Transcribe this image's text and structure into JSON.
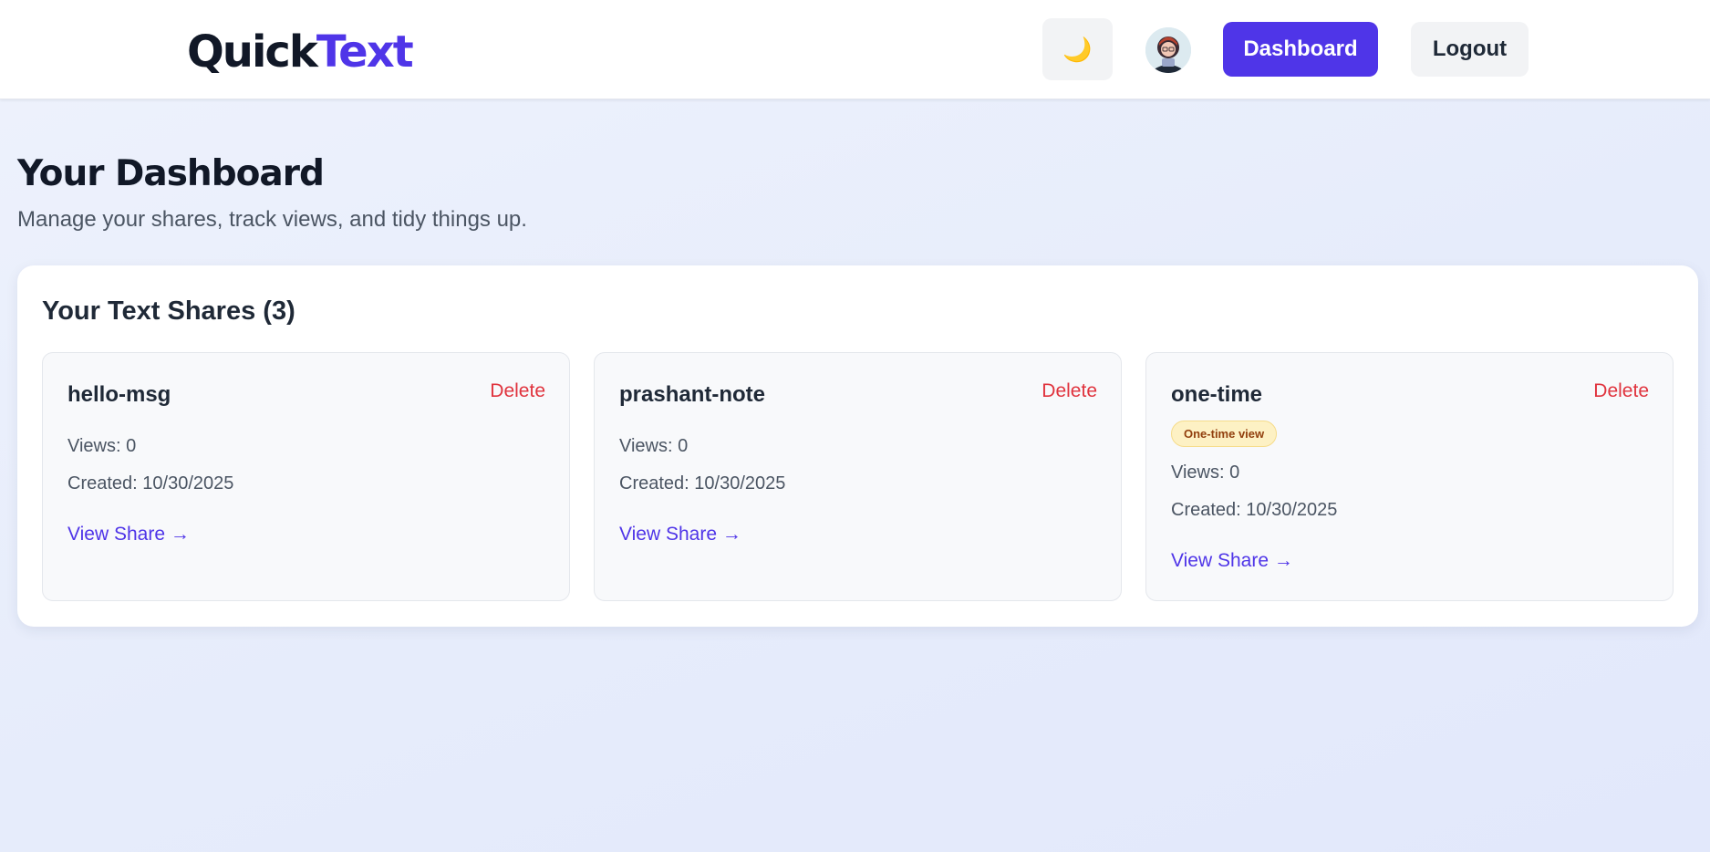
{
  "header": {
    "logo_part1": "Quick",
    "logo_part2": "Text",
    "theme_icon": "🌙",
    "dashboard_label": "Dashboard",
    "logout_label": "Logout"
  },
  "main": {
    "title": "Your Dashboard",
    "subtitle": "Manage your shares, track views, and tidy things up.",
    "panel_title": "Your Text Shares (3)"
  },
  "shares": [
    {
      "name": "hello-msg",
      "delete_label": "Delete",
      "badge": "",
      "views": "Views: 0",
      "created": "Created: 10/30/2025",
      "view_link": "View Share →"
    },
    {
      "name": "prashant-note",
      "delete_label": "Delete",
      "badge": "",
      "views": "Views: 0",
      "created": "Created: 10/30/2025",
      "view_link": "View Share →"
    },
    {
      "name": "one-time",
      "delete_label": "Delete",
      "badge": "One-time view",
      "views": "Views: 0",
      "created": "Created: 10/30/2025",
      "view_link": "View Share →"
    }
  ],
  "colors": {
    "brand": "#4f35e8",
    "danger": "#e0333d",
    "badge_bg": "#fdf1c4"
  },
  "icons": {
    "theme_toggle": "moon-icon",
    "user": "avatar"
  }
}
